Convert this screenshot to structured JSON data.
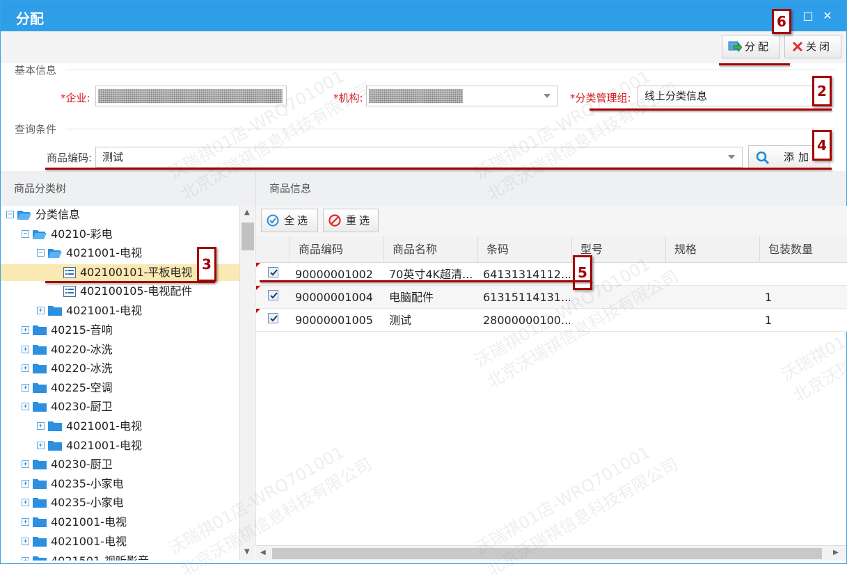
{
  "window": {
    "title": "分配"
  },
  "toolbar": {
    "assign_label": "分配",
    "close_label": "关闭"
  },
  "basic_info": {
    "section_label": "基本信息",
    "enterprise_label": "企业:",
    "org_label": "机构:",
    "group_label": "分类管理组:",
    "group_value": "线上分类信息",
    "required_mark": "*"
  },
  "query": {
    "section_label": "查询条件",
    "code_label": "商品编码:",
    "code_value": "测试",
    "add_label": "添加"
  },
  "tree_panel": {
    "header": "商品分类树",
    "nodes": [
      {
        "label": "分类信息",
        "toggle": "−"
      },
      {
        "label": "40210-彩电",
        "toggle": "−"
      },
      {
        "label": "4021001-电视",
        "toggle": "−"
      },
      {
        "label": "402100101-平板电视"
      },
      {
        "label": "402100105-电视配件"
      },
      {
        "label": "4021001-电视",
        "toggle": "+"
      },
      {
        "label": "40215-音响",
        "toggle": "+"
      },
      {
        "label": "40220-冰洗",
        "toggle": "+"
      },
      {
        "label": "40220-冰洗",
        "toggle": "+"
      },
      {
        "label": "40225-空调",
        "toggle": "+"
      },
      {
        "label": "40230-厨卫",
        "toggle": "+"
      },
      {
        "label": "4021001-电视",
        "toggle": "+"
      },
      {
        "label": "4021001-电视",
        "toggle": "+"
      },
      {
        "label": "40230-厨卫",
        "toggle": "+"
      },
      {
        "label": "40235-小家电",
        "toggle": "+"
      },
      {
        "label": "40235-小家电",
        "toggle": "+"
      },
      {
        "label": "4021001-电视",
        "toggle": "+"
      },
      {
        "label": "4021001-电视",
        "toggle": "+"
      },
      {
        "label": "4021501-视听影音",
        "toggle": "+"
      }
    ]
  },
  "product_panel": {
    "header": "商品信息",
    "select_all_label": "全选",
    "reselect_label": "重选",
    "columns": [
      "商品编码",
      "商品名称",
      "条码",
      "型号",
      "规格",
      "包装数量"
    ],
    "rows": [
      {
        "code": "90000001002",
        "name": "70英寸4K超清...",
        "barcode": "64131314112...",
        "model": "",
        "spec": "",
        "qty": ""
      },
      {
        "code": "90000001004",
        "name": "电脑配件",
        "barcode": "61315114131...",
        "model": "",
        "spec": "",
        "qty": "1"
      },
      {
        "code": "90000001005",
        "name": "测试",
        "barcode": "28000000100...",
        "model": "",
        "spec": "",
        "qty": "1"
      }
    ]
  },
  "watermark": {
    "line1": "沃瑞祺01店-WRQ701001",
    "line2": "北京沃瑞祺信息科技有限公司"
  },
  "annotations": [
    "2",
    "3",
    "4",
    "5",
    "6"
  ],
  "colors": {
    "titlebar": "#2f9ee8",
    "annotation": "#a50000",
    "required": "#d9191d",
    "selected_row": "#fbe9b3"
  }
}
